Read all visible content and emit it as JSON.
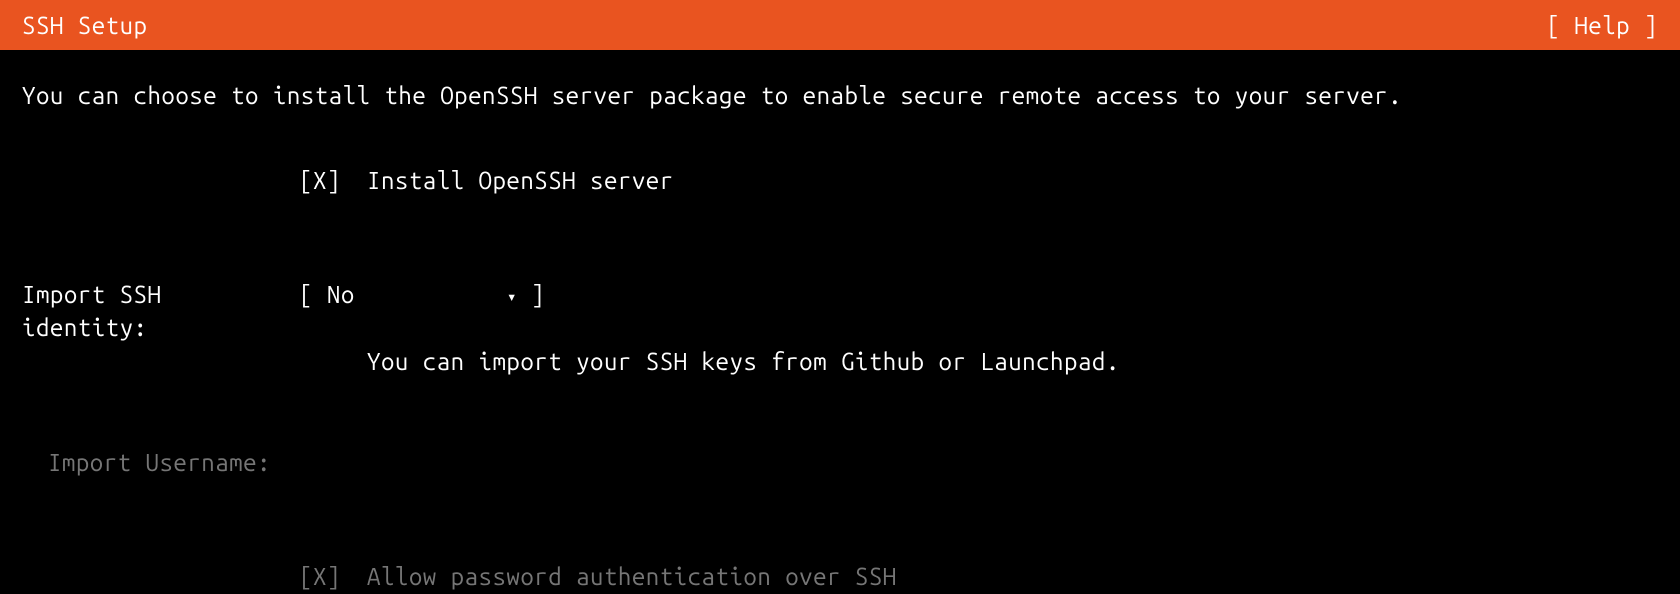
{
  "header": {
    "title": "SSH Setup",
    "help": "[ Help ]"
  },
  "intro": "You can choose to install the OpenSSH server package to enable secure remote access to your server.",
  "install": {
    "checkbox": "[X]",
    "label": "Install OpenSSH server"
  },
  "import": {
    "label": "Import SSH identity:",
    "bracket_open": "[ ",
    "value": "No",
    "bracket_close": " ]",
    "triangle": "▾",
    "help": "You can import your SSH keys from Github or Launchpad."
  },
  "username": {
    "label": "Import Username:"
  },
  "allow_password": {
    "checkbox": "[X]",
    "label": "Allow password authentication over SSH"
  }
}
